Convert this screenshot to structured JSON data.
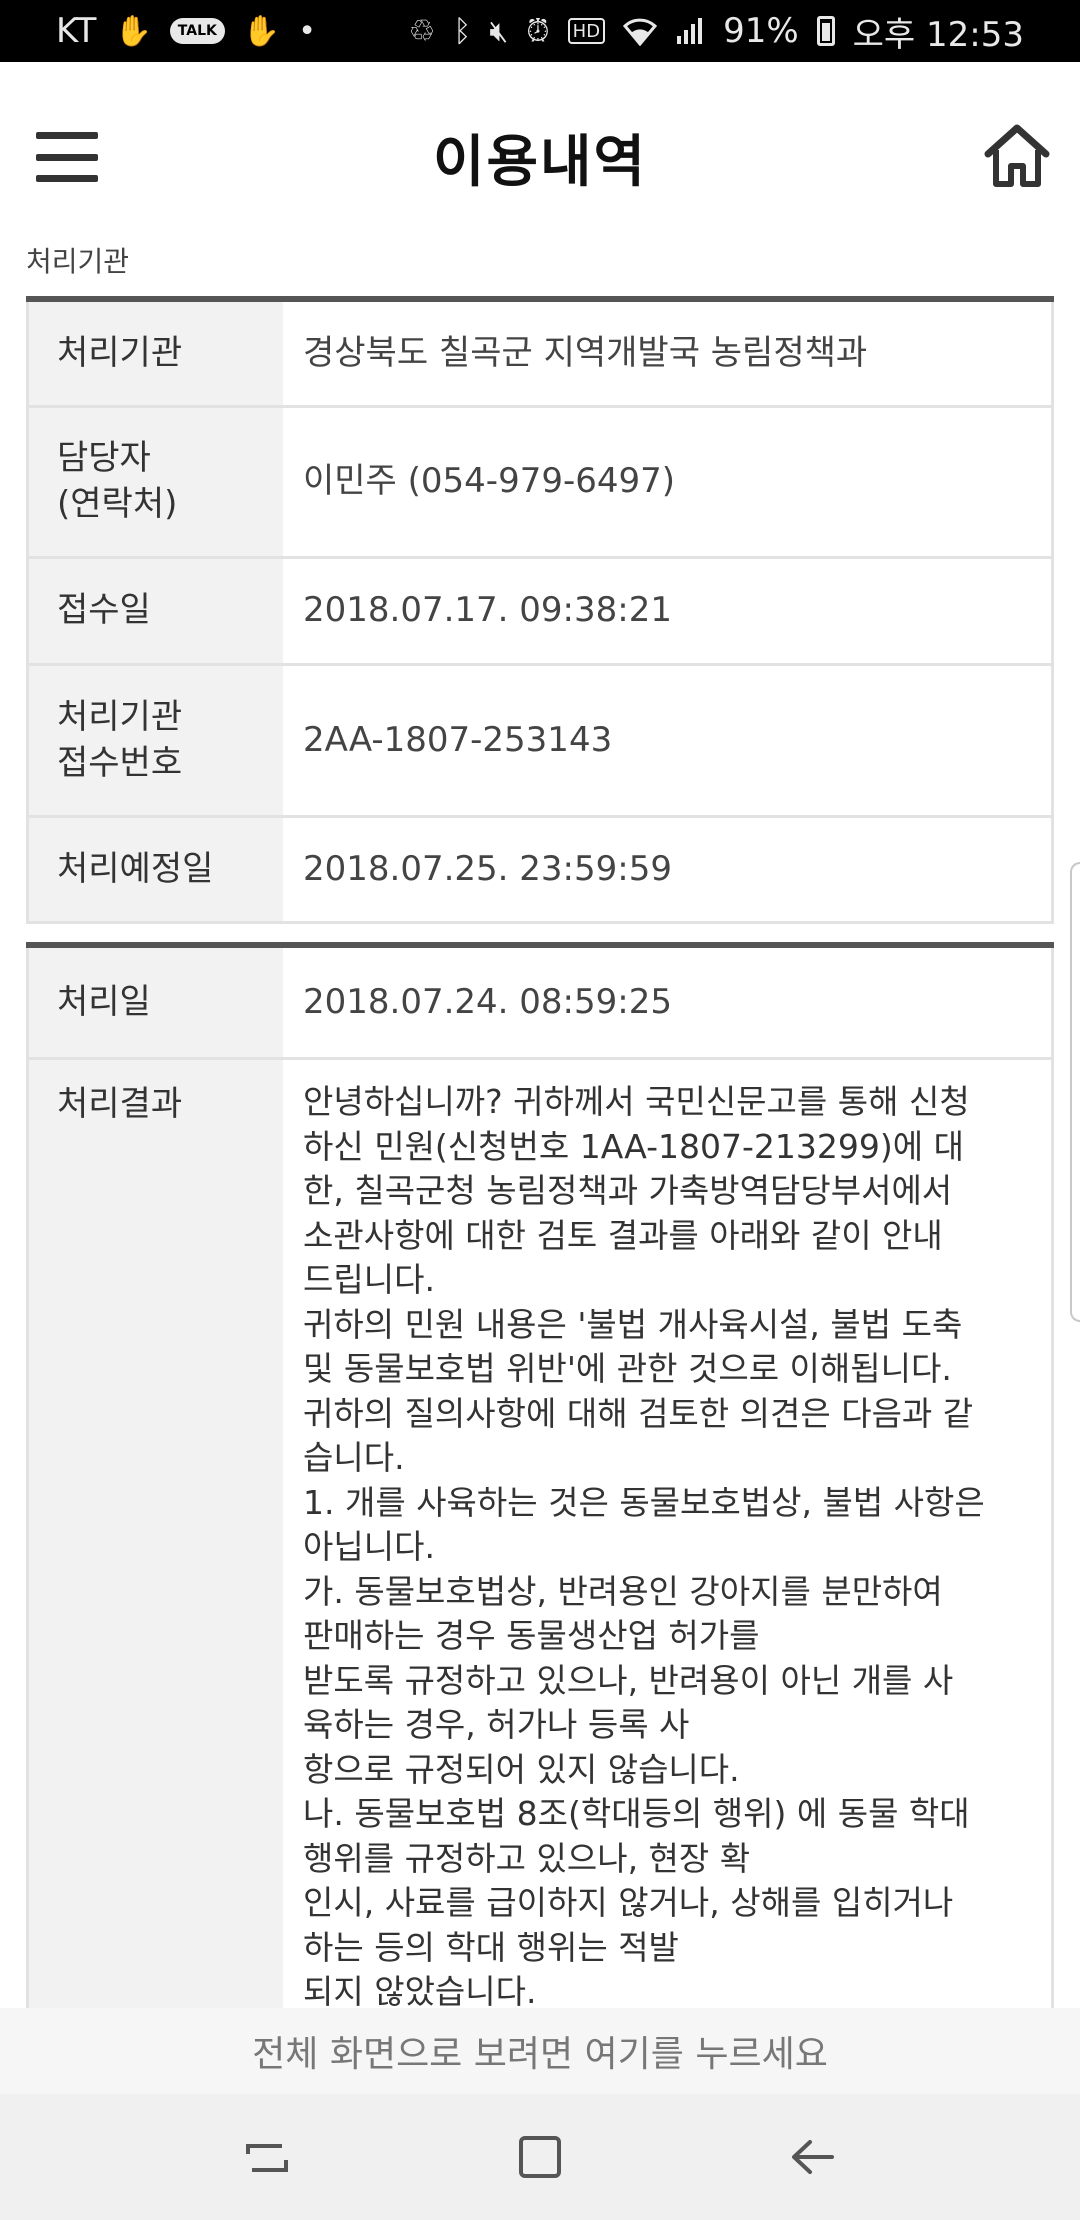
{
  "status_bar": {
    "carrier": "KT",
    "talk_label": "TALK",
    "battery": "91%",
    "time": "오후 12:53",
    "hd_label": "HD"
  },
  "header": {
    "title": "이용내역"
  },
  "section_label": "처리기관",
  "table1": {
    "rows": [
      {
        "label": "처리기관",
        "value": "경상북도 칠곡군 지역개발국 농림정책과"
      },
      {
        "label": "담당자\n(연락처)",
        "value": "이민주 (054-979-6497)"
      },
      {
        "label": "접수일",
        "value": "2018.07.17. 09:38:21"
      },
      {
        "label": "처리기관\n접수번호",
        "value": "2AA-1807-253143"
      },
      {
        "label": "처리예정일",
        "value": "2018.07.25. 23:59:59"
      }
    ]
  },
  "table2": {
    "date_label": "처리일",
    "date_value": "2018.07.24. 08:59:25",
    "result_label": "처리결과",
    "result_text": "안녕하십니까? 귀하께서 국민신문고를 통해 신청\n하신 민원(신청번호 1AA-1807-213299)에 대\n한, 칠곡군청 농림정책과 가축방역담당부서에서\n소관사항에 대한 검토 결과를 아래와 같이 안내\n드립니다.\n귀하의 민원 내용은 '불법 개사육시설, 불법 도축\n및 동물보호법 위반'에 관한 것으로 이해됩니다.\n귀하의 질의사항에 대해 검토한 의견은 다음과 같\n습니다.\n1. 개를 사육하는 것은 동물보호법상, 불법 사항은\n아닙니다.\n가. 동물보호법상, 반려용인 강아지를 분만하여\n판매하는 경우 동물생산업 허가를\n받도록 규정하고 있으나, 반려용이 아닌 개를 사\n육하는 경우, 허가나 등록 사\n항으로 규정되어 있지 않습니다.\n나. 동물보호법 8조(학대등의 행위) 에 동물 학대\n행위를 규정하고 있으나, 현장 확\n인시, 사료를 급이하지 않거나, 상해를 입히거나\n하는 등의 학대 행위는 적발\n되지 않았습니다."
  },
  "fullscreen_notice": "전체 화면으로 보려면 여기를 누르세요",
  "icons": {
    "menu": "hamburger-menu-icon",
    "home": "home-icon",
    "recents": "recents-icon",
    "overview": "overview-icon",
    "back": "back-icon"
  }
}
